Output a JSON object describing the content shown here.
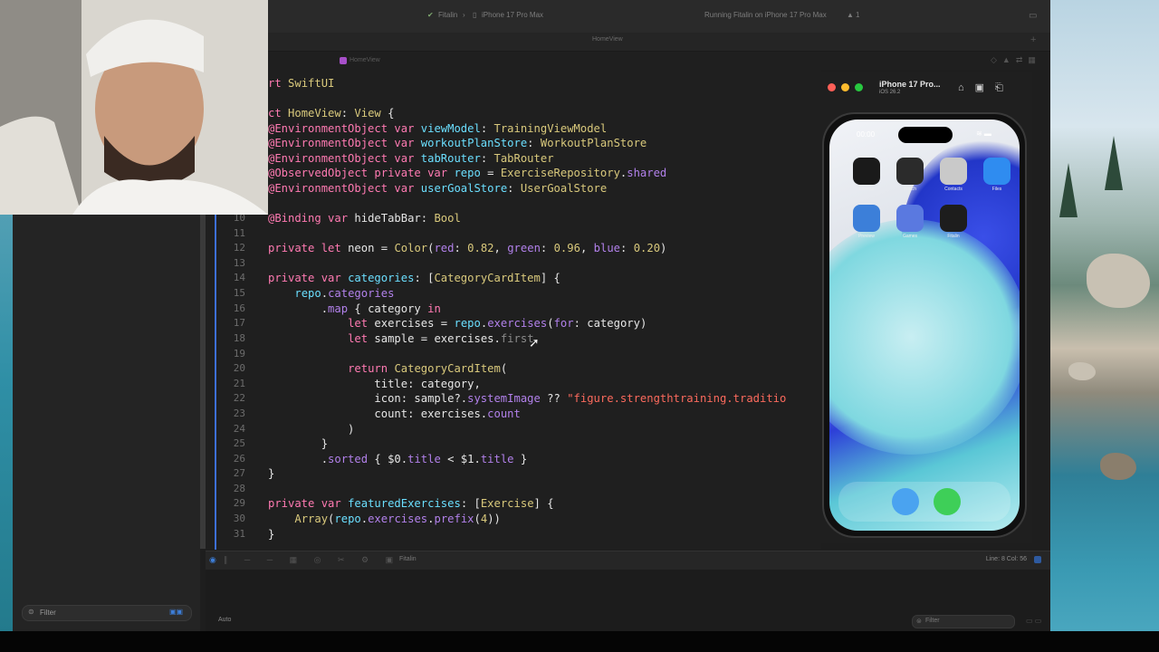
{
  "toolbar": {
    "scheme": "Fitalin",
    "destination": "iPhone 17 Pro Max",
    "status": "Running Fitalin on iPhone 17 Pro Max",
    "warnings": "1"
  },
  "tab": {
    "label": "HomeView"
  },
  "jumpbar": {
    "file": "HomeView"
  },
  "editor": {
    "lines": [
      {
        "num": "",
        "segments": [
          [
            "k",
            "rt "
          ],
          [
            "t",
            "SwiftUI"
          ]
        ]
      },
      {
        "num": "",
        "segments": [
          [
            "c",
            ""
          ]
        ]
      },
      {
        "num": "",
        "segments": [
          [
            "k",
            "ct "
          ],
          [
            "t",
            "HomeView"
          ],
          [
            "c",
            ": "
          ],
          [
            "t",
            "View"
          ],
          [
            "c",
            " {"
          ]
        ]
      },
      {
        "num": "",
        "segments": [
          [
            "k",
            "@EnvironmentObject var "
          ],
          [
            "p",
            "viewModel"
          ],
          [
            "c",
            ": "
          ],
          [
            "t",
            "TrainingViewModel"
          ]
        ]
      },
      {
        "num": "",
        "segments": [
          [
            "k",
            "@EnvironmentObject var "
          ],
          [
            "p",
            "workoutPlanStore"
          ],
          [
            "c",
            ": "
          ],
          [
            "t",
            "WorkoutPlanStore"
          ]
        ]
      },
      {
        "num": "",
        "segments": [
          [
            "k",
            "@EnvironmentObject var "
          ],
          [
            "p",
            "tabRouter"
          ],
          [
            "c",
            ": "
          ],
          [
            "t",
            "TabRouter"
          ]
        ]
      },
      {
        "num": "",
        "segments": [
          [
            "k",
            "@ObservedObject private var "
          ],
          [
            "p",
            "repo"
          ],
          [
            "c",
            " = "
          ],
          [
            "t",
            "ExerciseRepository"
          ],
          [
            "c",
            "."
          ],
          [
            "pr",
            "shared"
          ]
        ]
      },
      {
        "num": "",
        "segments": [
          [
            "k",
            "@EnvironmentObject var "
          ],
          [
            "p",
            "userGoalStore"
          ],
          [
            "c",
            ": "
          ],
          [
            "t",
            "UserGoalStore"
          ]
        ]
      },
      {
        "num": "",
        "segments": [
          [
            "c",
            ""
          ]
        ]
      },
      {
        "num": "10",
        "segments": [
          [
            "k",
            "@Binding var "
          ],
          [
            "c",
            "hideTabBar"
          ],
          [
            "c",
            ": "
          ],
          [
            "t",
            "Bool"
          ]
        ]
      },
      {
        "num": "11",
        "segments": [
          [
            "c",
            ""
          ]
        ]
      },
      {
        "num": "12",
        "segments": [
          [
            "k",
            "private let "
          ],
          [
            "c",
            "neon"
          ],
          [
            "c",
            " = "
          ],
          [
            "t",
            "Color"
          ],
          [
            "c",
            "("
          ],
          [
            "pr",
            "red"
          ],
          [
            "c",
            ": "
          ],
          [
            "n",
            "0.82"
          ],
          [
            "c",
            ", "
          ],
          [
            "pr",
            "green"
          ],
          [
            "c",
            ": "
          ],
          [
            "n",
            "0.96"
          ],
          [
            "c",
            ", "
          ],
          [
            "pr",
            "blue"
          ],
          [
            "c",
            ": "
          ],
          [
            "n",
            "0.20"
          ],
          [
            "c",
            ")"
          ]
        ]
      },
      {
        "num": "13",
        "segments": [
          [
            "c",
            ""
          ]
        ]
      },
      {
        "num": "14",
        "segments": [
          [
            "k",
            "private var "
          ],
          [
            "p",
            "categories"
          ],
          [
            "c",
            ": ["
          ],
          [
            "t",
            "CategoryCardItem"
          ],
          [
            "c",
            "] {"
          ]
        ]
      },
      {
        "num": "15",
        "segments": [
          [
            "c",
            "    "
          ],
          [
            "p",
            "repo"
          ],
          [
            "c",
            "."
          ],
          [
            "pr",
            "categories"
          ]
        ]
      },
      {
        "num": "16",
        "segments": [
          [
            "c",
            "        ."
          ],
          [
            "pr",
            "map"
          ],
          [
            "c",
            " { category "
          ],
          [
            "k",
            "in"
          ]
        ]
      },
      {
        "num": "17",
        "segments": [
          [
            "c",
            "            "
          ],
          [
            "k",
            "let "
          ],
          [
            "c",
            "exercises = "
          ],
          [
            "p",
            "repo"
          ],
          [
            "c",
            "."
          ],
          [
            "pr",
            "exercises"
          ],
          [
            "c",
            "("
          ],
          [
            "pr",
            "for"
          ],
          [
            "c",
            ": category)"
          ]
        ]
      },
      {
        "num": "18",
        "segments": [
          [
            "c",
            "            "
          ],
          [
            "k",
            "let "
          ],
          [
            "c",
            "sample = exercises."
          ],
          [
            "hl",
            "first"
          ]
        ]
      },
      {
        "num": "19",
        "segments": [
          [
            "c",
            ""
          ]
        ]
      },
      {
        "num": "20",
        "segments": [
          [
            "c",
            "            "
          ],
          [
            "k",
            "return "
          ],
          [
            "t",
            "CategoryCardItem"
          ],
          [
            "c",
            "("
          ]
        ]
      },
      {
        "num": "21",
        "segments": [
          [
            "c",
            "                title: category,"
          ]
        ]
      },
      {
        "num": "22",
        "segments": [
          [
            "c",
            "                icon: sample?."
          ],
          [
            "pr",
            "systemImage"
          ],
          [
            "c",
            " ?? "
          ],
          [
            "s",
            "\"figure.strengthtraining.traditio"
          ]
        ]
      },
      {
        "num": "23",
        "segments": [
          [
            "c",
            "                count: exercises."
          ],
          [
            "pr",
            "count"
          ]
        ]
      },
      {
        "num": "24",
        "segments": [
          [
            "c",
            "            )"
          ]
        ]
      },
      {
        "num": "25",
        "segments": [
          [
            "c",
            "        }"
          ]
        ]
      },
      {
        "num": "26",
        "segments": [
          [
            "c",
            "        ."
          ],
          [
            "pr",
            "sorted"
          ],
          [
            "c",
            " { $0."
          ],
          [
            "pr",
            "title"
          ],
          [
            "c",
            " < $1."
          ],
          [
            "pr",
            "title"
          ],
          [
            "c",
            " }"
          ]
        ]
      },
      {
        "num": "27",
        "segments": [
          [
            "c",
            "}"
          ]
        ]
      },
      {
        "num": "28",
        "segments": [
          [
            "c",
            ""
          ]
        ]
      },
      {
        "num": "29",
        "segments": [
          [
            "k",
            "private var "
          ],
          [
            "p",
            "featuredExercises"
          ],
          [
            "c",
            ": ["
          ],
          [
            "t",
            "Exercise"
          ],
          [
            "c",
            "] {"
          ]
        ]
      },
      {
        "num": "30",
        "segments": [
          [
            "c",
            "    "
          ],
          [
            "t",
            "Array"
          ],
          [
            "c",
            "("
          ],
          [
            "p",
            "repo"
          ],
          [
            "c",
            "."
          ],
          [
            "pr",
            "exercises"
          ],
          [
            "c",
            "."
          ],
          [
            "pr",
            "prefix"
          ],
          [
            "c",
            "("
          ],
          [
            "n",
            "4"
          ],
          [
            "c",
            "))"
          ]
        ]
      },
      {
        "num": "31",
        "segments": [
          [
            "c",
            "}"
          ]
        ]
      }
    ]
  },
  "debug": {
    "target": "Fitalin",
    "position": "Line: 8  Col: 56"
  },
  "console": {
    "mode": "Auto",
    "filter_placeholder": "Filter"
  },
  "navigator": {
    "filter_placeholder": "Filter"
  },
  "simulator": {
    "device": "iPhone 17 Pro...",
    "os": "iOS 26.2",
    "time": "00:00",
    "apps": [
      {
        "name": "Fitness",
        "color": "#1a1a1a"
      },
      {
        "name": "Watch",
        "color": "#2b2b2b"
      },
      {
        "name": "Contacts",
        "color": "#c9c9c9"
      },
      {
        "name": "Files",
        "color": "#2f8cf0"
      },
      {
        "name": "Preview",
        "color": "#3c7fd9"
      },
      {
        "name": "Games",
        "color": "#5a79e0"
      },
      {
        "name": "Fitalin",
        "color": "#1d1d1d"
      }
    ],
    "dock": [
      {
        "name": "Safari",
        "color": "#4aa3f0"
      },
      {
        "name": "Messages",
        "color": "#3ecf58"
      }
    ]
  }
}
